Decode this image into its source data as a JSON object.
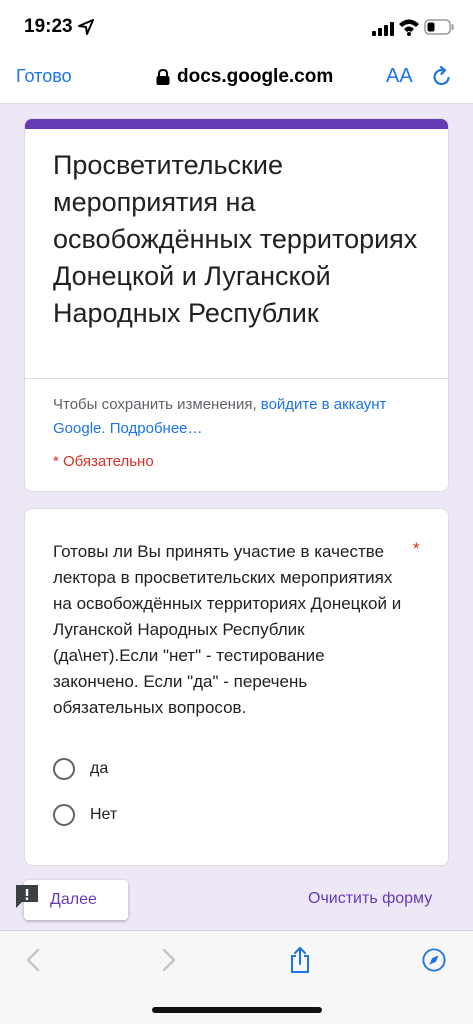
{
  "status_bar": {
    "time": "19:23"
  },
  "browser": {
    "done_label": "Готово",
    "url": "docs.google.com",
    "text_size_label": "AA"
  },
  "form": {
    "title": "Просветительские мероприятия на освобождённых территориях Донецкой и Луганской Народных Республик",
    "signin_prefix": "Чтобы сохранить изменения, ",
    "signin_link": "войдите в аккаунт Google.",
    "learn_more": " Подробнее…",
    "required_note": "* Обязательно",
    "accent_color": "#673ab7",
    "background_color": "#ede7f6"
  },
  "question": {
    "text": "Готовы ли Вы принять участие в качестве лектора в просветительских мероприятиях на освобождённых территориях Донецкой и Луганской Народных Республик (да\\нет).Если \"нет\" - тестирование закончено. Если \"да\" - перечень обязательных вопросов.",
    "required_mark": "*",
    "options": [
      {
        "label": "да"
      },
      {
        "label": "Нет"
      }
    ]
  },
  "actions": {
    "next_label": "Далее",
    "clear_label": "Очистить форму"
  },
  "icons": {
    "location": "location-arrow-icon",
    "signal": "signal-icon",
    "wifi": "wifi-icon",
    "battery": "battery-icon",
    "lock": "lock-icon",
    "reload": "reload-icon",
    "report": "report-icon",
    "back": "back-icon",
    "forward": "forward-icon",
    "share": "share-icon",
    "compass": "compass-icon"
  }
}
